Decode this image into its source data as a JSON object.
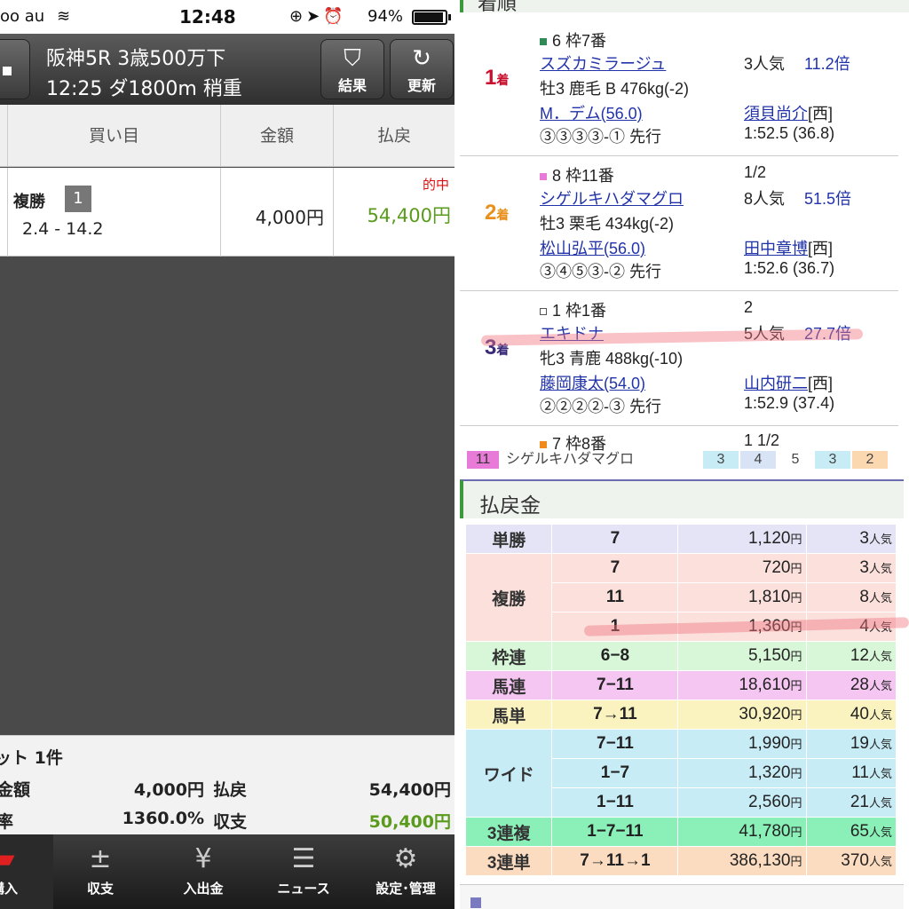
{
  "status_bar": {
    "carrier": "oo au",
    "time": "12:48",
    "battery": "94%"
  },
  "header": {
    "race_title": "阪神5R 3歳500万下",
    "race_sub": "12:25 ダ1800m 稍重",
    "result_label": "結果",
    "refresh_label": "更新"
  },
  "bet_table": {
    "col_buy": "買い目",
    "col_amount": "金額",
    "col_payout": "払戻",
    "row": {
      "type": "複勝",
      "number": "1",
      "odds": "2.4 - 14.2",
      "amount": "4,000円",
      "hit": "的中",
      "payout": "54,400円"
    }
  },
  "summary": {
    "count_label": "ット 1件",
    "amount_label": "金額",
    "amount_value": "4,000円",
    "payout_label": "払戻",
    "payout_value": "54,400円",
    "rate_label": "率",
    "rate_value": "1360.0%",
    "balance_label": "収支",
    "balance_value": "50,400円"
  },
  "tabs": [
    {
      "label": "購入",
      "icon": "ticket-icon"
    },
    {
      "label": "収支",
      "icon": "plus-minus-icon"
    },
    {
      "label": "入出金",
      "icon": "yen-icon"
    },
    {
      "label": "ニュース",
      "icon": "news-icon"
    },
    {
      "label": "設定･管理",
      "icon": "gear-icon"
    }
  ],
  "order_section": {
    "title": "着順"
  },
  "places": [
    {
      "pos": "1",
      "pos_suffix": "着",
      "pos_color": "#c8102e",
      "frame": "6 枠7番",
      "frame_color": "#2e8b57",
      "margin": "",
      "horse": "スズカミラージュ",
      "popularity": "3人気",
      "odds": "11.2倍",
      "info": "牡3 鹿毛 B 476kg(-2)",
      "jockey": "M．デム(56.0)",
      "trainer": "須貝尚介",
      "trainer_region": "[西]",
      "passing": "③③③③-① 先行",
      "time": "1:52.5 (36.8)"
    },
    {
      "pos": "2",
      "pos_suffix": "着",
      "pos_color": "#e8901a",
      "frame": "8 枠11番",
      "frame_color": "#e87ad8",
      "margin": "1/2",
      "horse": "シゲルキハダマグロ",
      "popularity": "8人気",
      "odds": "51.5倍",
      "info": "牡3 栗毛 434kg(-2)",
      "jockey": "松山弘平(56.0)",
      "trainer": "田中章博",
      "trainer_region": "[西]",
      "passing": "③④⑤③-② 先行",
      "time": "1:52.6 (36.7)"
    },
    {
      "pos": "3",
      "pos_suffix": "着",
      "pos_color": "#3a2a7a",
      "frame": "1 枠1番",
      "frame_color": "#ffffff",
      "margin": "2",
      "horse": "エキドナ",
      "popularity": "5人気",
      "odds": "27.7倍",
      "info": "牝3 青鹿 488kg(-10)",
      "jockey": "藤岡康太(54.0)",
      "trainer": "山内研二",
      "trainer_region": "[西]",
      "passing": "②②②②-③ 先行",
      "time": "1:52.9 (37.4)"
    },
    {
      "frame": "7 枠8番",
      "frame_color": "#f08a1c",
      "margin": "1 1/2"
    }
  ],
  "mini_strip": {
    "num": "11",
    "name": "シゲルキハダマグロ",
    "cells": [
      "3",
      "4",
      "5",
      "3",
      "2"
    ]
  },
  "payout_section": {
    "title": "払戻金"
  },
  "payouts": [
    {
      "kind": "単勝",
      "bg": "#e4e4f6",
      "rows": [
        {
          "nums": "7",
          "yen": "1,120",
          "pop": "3"
        }
      ]
    },
    {
      "kind": "複勝",
      "bg": "#fbe0dc",
      "rows": [
        {
          "nums": "7",
          "yen": "720",
          "pop": "3"
        },
        {
          "nums": "11",
          "yen": "1,810",
          "pop": "8"
        },
        {
          "nums": "1",
          "yen": "1,360",
          "pop": "4"
        }
      ]
    },
    {
      "kind": "枠連",
      "bg": "#d8f6d8",
      "rows": [
        {
          "nums": "6−8",
          "yen": "5,150",
          "pop": "12"
        }
      ]
    },
    {
      "kind": "馬連",
      "bg": "#f6c6f2",
      "rows": [
        {
          "nums": "7−11",
          "yen": "18,610",
          "pop": "28"
        }
      ]
    },
    {
      "kind": "馬単",
      "bg": "#faf3c0",
      "rows": [
        {
          "nums": "7→11",
          "yen": "30,920",
          "pop": "40"
        }
      ]
    },
    {
      "kind": "ワイド",
      "bg": "#c8ecf6",
      "rows": [
        {
          "nums": "7−11",
          "yen": "1,990",
          "pop": "19"
        },
        {
          "nums": "1−7",
          "yen": "1,320",
          "pop": "11"
        },
        {
          "nums": "1−11",
          "yen": "2,560",
          "pop": "21"
        }
      ]
    },
    {
      "kind": "3連複",
      "bg": "#8af0b8",
      "rows": [
        {
          "nums": "1−7−11",
          "yen": "41,780",
          "pop": "65"
        }
      ]
    },
    {
      "kind": "3連単",
      "bg": "#fcdcc0",
      "rows": [
        {
          "nums": "7→11→1",
          "yen": "386,130",
          "pop": "370"
        }
      ]
    }
  ],
  "units": {
    "yen": "円",
    "pop": "人気"
  },
  "colors": {
    "win_green": "#5a9a1c",
    "hit_red": "#d11111",
    "link_blue": "#2233aa",
    "highlight": "#f07882"
  }
}
